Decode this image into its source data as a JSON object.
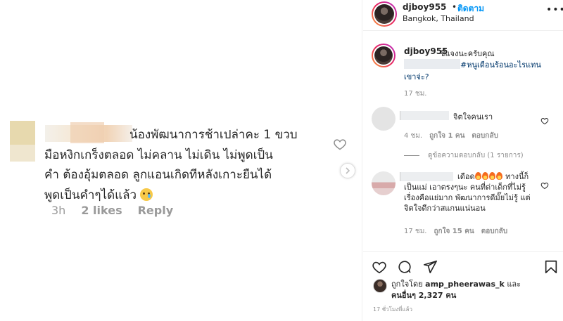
{
  "image_comment": {
    "text_line1": "น้องพัฒนาการช้าเปล่าคะ 1 ขวบ",
    "text_line2": "มือหงิกเกร็งตลอด ไม่คลาน ไม่เดิน ไม่พูดเป็น",
    "text_line3": "คำ ต้องอุ้มตลอด ลูกแอนเกิดทีหลังเกาะยืนได้",
    "text_line4": "พูดเป็นคำๆได้แล้ว",
    "time": "3h",
    "likes": "2 likes",
    "reply": "Reply"
  },
  "header": {
    "username": "djboy955",
    "dot": "•",
    "follow": "ติดตาม",
    "location": "Bangkok, Thailand",
    "more": "•••"
  },
  "caption": {
    "username": "djboy955",
    "text": "ชี้แจงนะครับคุณ",
    "hashtag": "#หนูเดือนร้อนอะไรแทนเขาจ่ะ?",
    "time": "17 ชม."
  },
  "comments": [
    {
      "text": "จิตใจคนเรา",
      "time": "4 ชม.",
      "likes": "ถูกใจ 1 คน",
      "reply": "ตอบกลับ",
      "view_replies": "ดูข้อความตอบกลับ (1 รายการ)"
    },
    {
      "text_start": "เดือด",
      "text_end": " ทางนี้ก็เป็นแม่ เอาตรงๆนะ คนที่ด่าเด็กที่ไม่รู้เรื่องคือแย่มาก พัฒนาการดีมั๊ยไม่รู้ แต่จิตใจดีกว่าสแกนแน่นอน",
      "time": "17 ชม.",
      "likes": "ถูกใจ 15 คน",
      "reply": "ตอบกลับ"
    }
  ],
  "likes_summary": {
    "prefix": "ถูกใจโดย ",
    "user": "amp_pheerawas_k",
    "middle": " และ",
    "others": "คนอื่นๆ 2,327 คน"
  },
  "post_time": "17 ชั่วโมงที่แล้ว",
  "colors": {
    "link_blue": "#0095f6",
    "hashtag": "#00376b",
    "muted": "#8e8e8e",
    "text": "#262626"
  }
}
